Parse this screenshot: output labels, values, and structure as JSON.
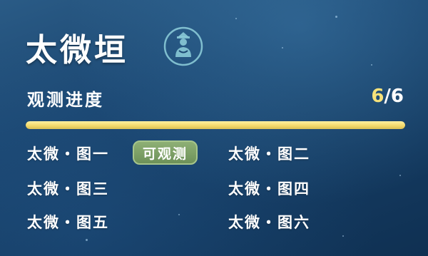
{
  "title": "太微垣",
  "emblem_icon": "immortal-figure-emblem-icon",
  "progress": {
    "label": "观测进度",
    "current": "6",
    "separator": "/",
    "total": "6",
    "fraction": 1.0,
    "fill_color": "#f1d86a"
  },
  "charts": [
    {
      "label": "太微・图一",
      "badge": "可观测"
    },
    {
      "label": "太微・图二"
    },
    {
      "label": "太微・图三"
    },
    {
      "label": "太微・图四"
    },
    {
      "label": "太微・图五"
    },
    {
      "label": "太微・图六"
    }
  ]
}
